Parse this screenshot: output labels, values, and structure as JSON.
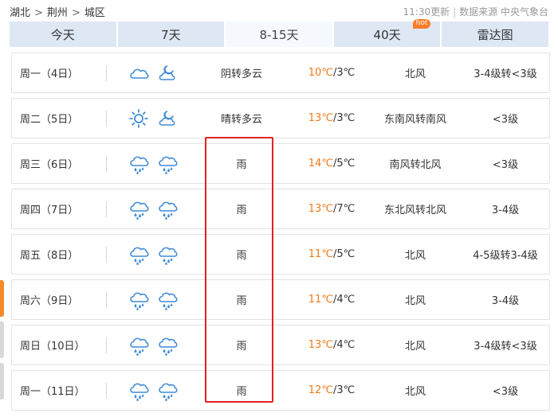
{
  "breadcrumb": [
    "湖北",
    "荆州",
    "城区"
  ],
  "breadcrumb_sep": ">",
  "update_info": {
    "time": "11:30更新",
    "source": "数据来源 中央气象台",
    "divider": "|"
  },
  "tabs": [
    {
      "label": "今天",
      "active": false
    },
    {
      "label": "7天",
      "active": false
    },
    {
      "label": "8-15天",
      "active": true
    },
    {
      "label": "40天",
      "active": false,
      "badge": "hot"
    },
    {
      "label": "雷达图",
      "active": false
    }
  ],
  "colors": {
    "accent_orange": "#f27a1a",
    "tab_bg": "#dde8f4",
    "highlight": "#e02222",
    "icon_blue": "#3f8bd6",
    "icon_sun": "#2a7fd4"
  },
  "rows": [
    {
      "day": "周一（4日）",
      "icons": [
        "cloud-icon",
        "moon-cloud-icon"
      ],
      "desc": "阴转多云",
      "hi": "10℃",
      "lo": "/3℃",
      "wind": "北风",
      "level": "3-4级转<3级"
    },
    {
      "day": "周二（5日）",
      "icons": [
        "sun-icon",
        "moon-cloud-icon"
      ],
      "desc": "晴转多云",
      "hi": "13℃",
      "lo": "/3℃",
      "wind": "东南风转南风",
      "level": "<3级"
    },
    {
      "day": "周三（6日）",
      "icons": [
        "rain-icon",
        "rain-icon"
      ],
      "desc": "雨",
      "hi": "14℃",
      "lo": "/5℃",
      "wind": "南风转北风",
      "level": "<3级"
    },
    {
      "day": "周四（7日）",
      "icons": [
        "rain-icon",
        "rain-icon"
      ],
      "desc": "雨",
      "hi": "13℃",
      "lo": "/7℃",
      "wind": "东北风转北风",
      "level": "3-4级"
    },
    {
      "day": "周五（8日）",
      "icons": [
        "rain-icon",
        "rain-icon"
      ],
      "desc": "雨",
      "hi": "11℃",
      "lo": "/5℃",
      "wind": "北风",
      "level": "4-5级转3-4级"
    },
    {
      "day": "周六（9日）",
      "icons": [
        "rain-icon",
        "rain-icon"
      ],
      "desc": "雨",
      "hi": "11℃",
      "lo": "/4℃",
      "wind": "北风",
      "level": "3-4级"
    },
    {
      "day": "周日（10日）",
      "icons": [
        "rain-icon",
        "rain-icon"
      ],
      "desc": "雨",
      "hi": "13℃",
      "lo": "/4℃",
      "wind": "北风",
      "level": "3-4级转<3级"
    },
    {
      "day": "周一（11日）",
      "icons": [
        "rain-icon",
        "rain-icon"
      ],
      "desc": "雨",
      "hi": "12℃",
      "lo": "/3℃",
      "wind": "北风",
      "level": "<3级"
    }
  ]
}
